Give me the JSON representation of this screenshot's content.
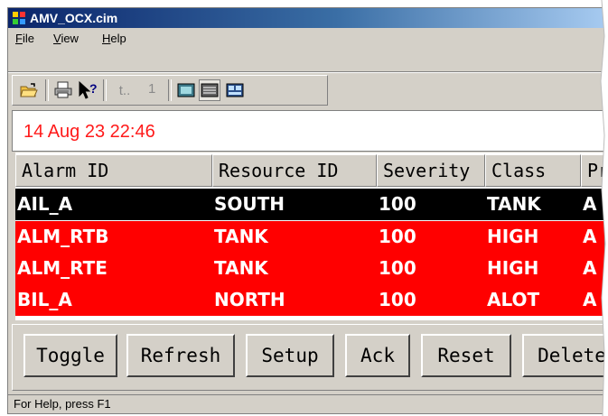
{
  "window": {
    "title": "AMV_OCX.cim"
  },
  "menu": [
    {
      "label": "File",
      "accel": "F",
      "rest": "ile"
    },
    {
      "label": "View",
      "accel": "V",
      "rest": "iew"
    },
    {
      "label": "Help",
      "accel": "H",
      "rest": "elp"
    }
  ],
  "toolbar": {
    "icons": [
      "open-folder-icon",
      "print-icon",
      "context-help-icon",
      "navigate-up-icon",
      "view-mode-1-icon",
      "view-mode-2-icon",
      "view-mode-3-icon"
    ],
    "nav_label": "t..",
    "page_number": "1"
  },
  "datetime": "14 Aug 23 22:46",
  "grid": {
    "columns": [
      "Alarm ID",
      "Resource ID",
      "Severity",
      "Class",
      "Pr"
    ],
    "rows": [
      {
        "alarm_id": "AIL_A",
        "resource_id": "SOUTH",
        "severity": "100",
        "class": "TANK",
        "pr": "A",
        "style": "black"
      },
      {
        "alarm_id": "ALM_RTB",
        "resource_id": "TANK",
        "severity": "100",
        "class": "HIGH",
        "pr": "A",
        "style": "red"
      },
      {
        "alarm_id": "ALM_RTE",
        "resource_id": "TANK",
        "severity": "100",
        "class": "HIGH",
        "pr": "A",
        "style": "red"
      },
      {
        "alarm_id": "BIL_A",
        "resource_id": "NORTH",
        "severity": "100",
        "class": "ALOT",
        "pr": "A",
        "style": "red"
      }
    ]
  },
  "buttons": [
    "Toggle",
    "Refresh",
    "Setup",
    "Ack",
    "Reset",
    "Delete"
  ],
  "status": "For Help, press F1",
  "colors": {
    "datetime": "#ff1a1a",
    "row_selected_bg": "#000000",
    "row_alarm_bg": "#ff0000",
    "row_text": "#ffffff",
    "window_face": "#d4d0c8"
  }
}
